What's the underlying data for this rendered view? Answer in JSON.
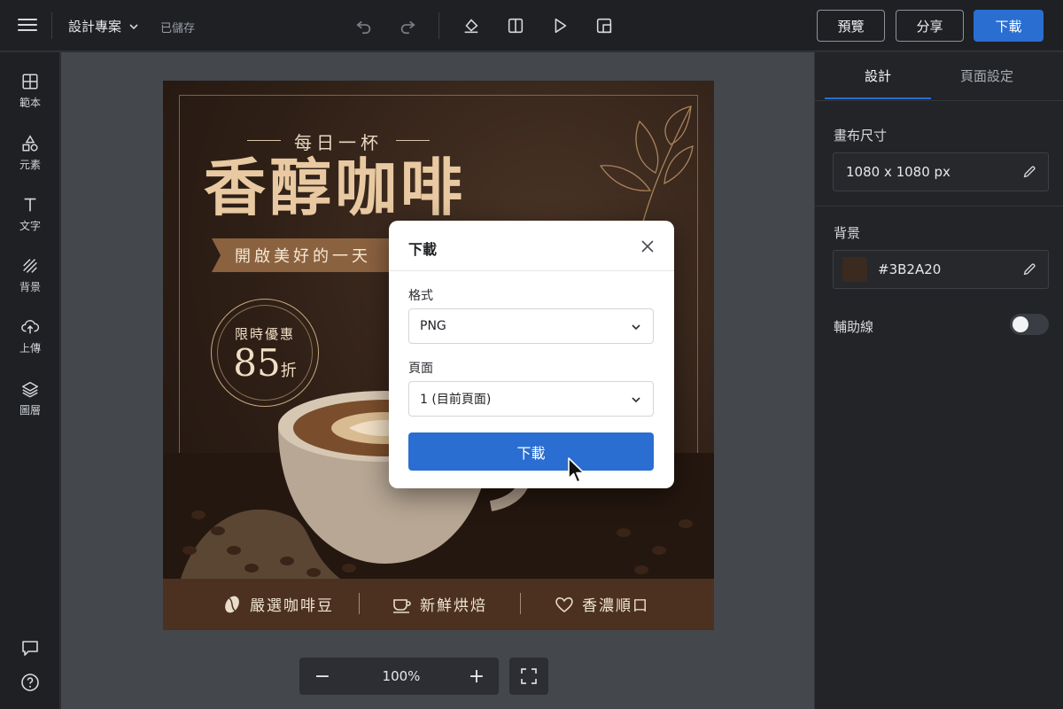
{
  "topbar": {
    "project_name": "設計專案",
    "saved_status": "已儲存",
    "preview_label": "預覽",
    "share_label": "分享",
    "download_label": "下載"
  },
  "sidebar": {
    "items": [
      {
        "label": "範本",
        "icon": "template-icon"
      },
      {
        "label": "元素",
        "icon": "elements-icon"
      },
      {
        "label": "文字",
        "icon": "text-icon"
      },
      {
        "label": "背景",
        "icon": "background-icon"
      },
      {
        "label": "上傳",
        "icon": "upload-icon"
      },
      {
        "label": "圖層",
        "icon": "layers-icon"
      }
    ]
  },
  "design": {
    "tagline": "每日一杯",
    "headline": "香醇咖啡",
    "ribbon": "開啟美好的一天",
    "badge_line1": "限時優惠",
    "badge_number": "85",
    "badge_unit": "折",
    "features": [
      "嚴選咖啡豆",
      "新鮮烘焙",
      "香濃順口"
    ]
  },
  "zoom": {
    "value": "100%",
    "minus": "−",
    "plus": "+"
  },
  "panel": {
    "tabs": [
      "設計",
      "頁面設定"
    ],
    "active_tab": 0,
    "canvas_size_label": "畫布尺寸",
    "canvas_size_value": "1080 x 1080 px",
    "background_label": "背景",
    "background_value": "#3B2A20",
    "guides_label": "輔助線",
    "guides_on": false
  },
  "modal": {
    "title": "下載",
    "format_label": "格式",
    "format_value": "PNG",
    "page_label": "頁面",
    "page_value": "1 (目前頁面)",
    "download_button": "下載"
  },
  "colors": {
    "accent": "#2a6ed1",
    "design_bg": "#3b2a20"
  }
}
